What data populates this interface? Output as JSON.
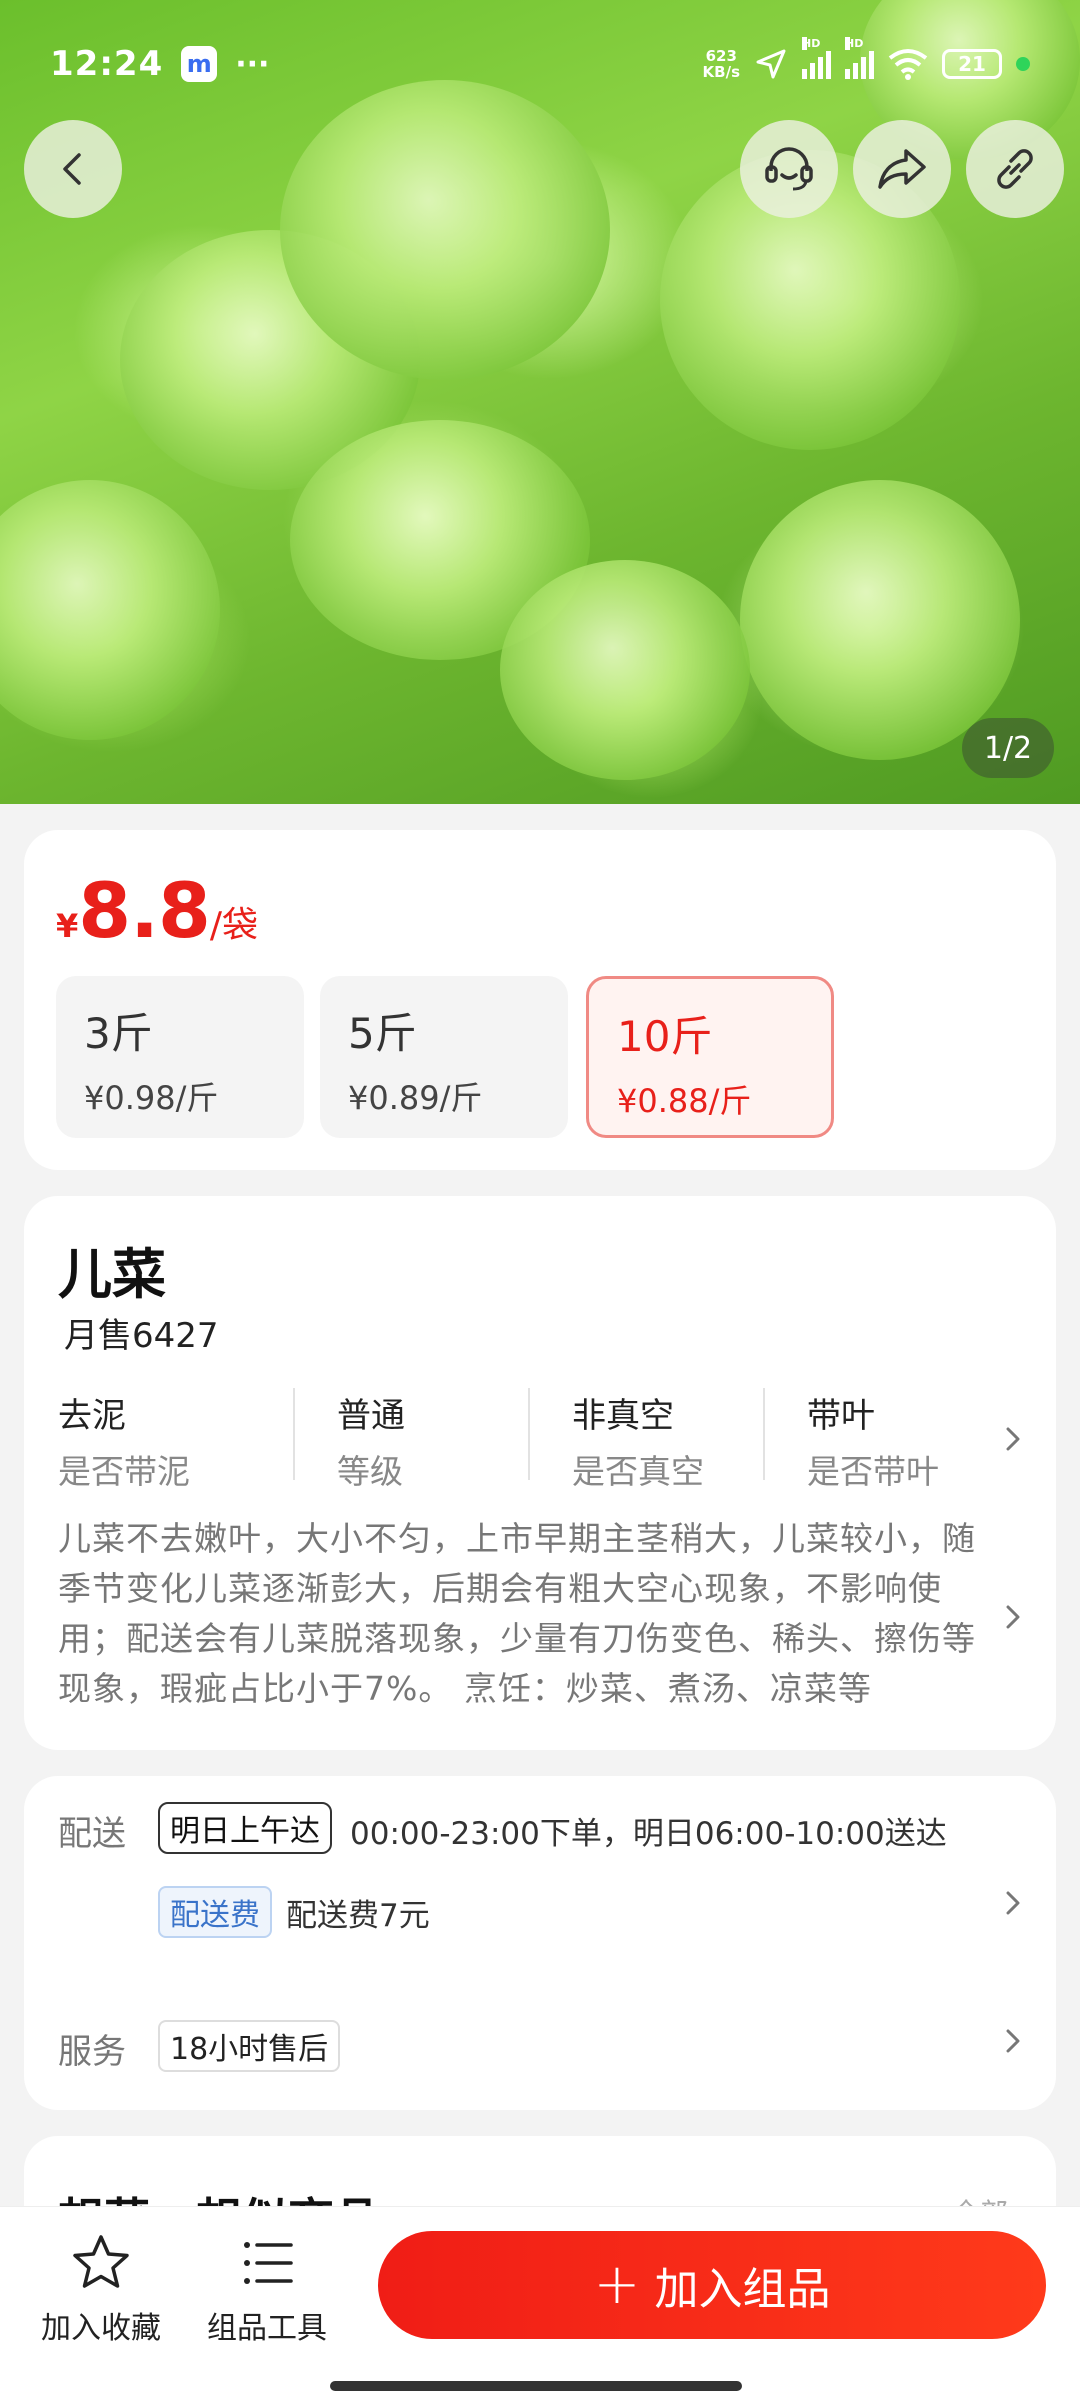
{
  "status_bar": {
    "time": "12:24",
    "app_badge": "m",
    "more": "···",
    "net_speed_top": "623",
    "net_speed_bottom": "KB/s",
    "hd1": "HD",
    "hd2": "HD",
    "battery": "21"
  },
  "gallery": {
    "counter": "1/2"
  },
  "price": {
    "currency": "¥",
    "value": "8.8",
    "unit": "/袋"
  },
  "specs": [
    {
      "weight": "3斤",
      "unit_price": "¥0.98/斤",
      "selected": false
    },
    {
      "weight": "5斤",
      "unit_price": "¥0.89/斤",
      "selected": false
    },
    {
      "weight": "10斤",
      "unit_price": "¥0.88/斤",
      "selected": true
    }
  ],
  "product": {
    "name": "儿菜",
    "monthly_sales": "月售6427",
    "attributes": [
      {
        "value": "去泥",
        "key": "是否带泥"
      },
      {
        "value": "普通",
        "key": "等级"
      },
      {
        "value": "非真空",
        "key": "是否真空"
      },
      {
        "value": "带叶",
        "key": "是否带叶"
      }
    ],
    "description": "儿菜不去嫩叶，大小不匀，上市早期主茎稍大，儿菜较小，随季节变化儿菜逐渐彭大，后期会有粗大空心现象，不影响使用；配送会有儿菜脱落现象，少量有刀伤变色、稀头、擦伤等现象，瑕疵占比小于7%。 烹饪：炒菜、煮汤、凉菜等"
  },
  "delivery": {
    "label": "配送",
    "tag": "明日上午达",
    "schedule": "00:00-23:00下单，明日06:00-10:00送达",
    "fee_tag": "配送费",
    "fee_text": "配送费7元",
    "service_label": "服务",
    "service_tag": "18小时售后"
  },
  "next_section": {
    "title": "想菜、想似商品",
    "more": "全部"
  },
  "bottom_bar": {
    "favorite_label": "加入收藏",
    "tools_label": "组品工具",
    "add_plus": "+",
    "add_label": "加入组品"
  },
  "colors": {
    "accent": "#e8201a",
    "button": "#f01d16"
  }
}
